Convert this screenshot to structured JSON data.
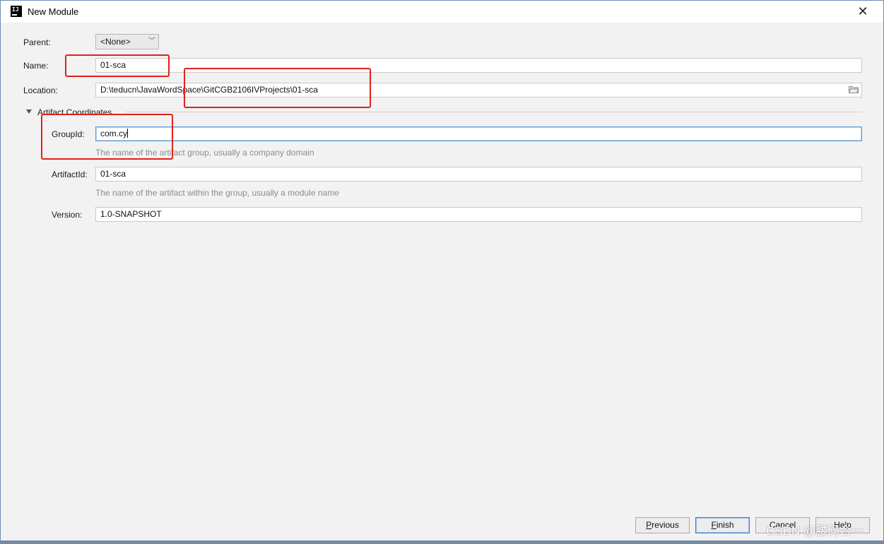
{
  "window": {
    "title": "New Module",
    "close_glyph": "✕",
    "app_icon_text": "IJ"
  },
  "form": {
    "parent": {
      "label": "Parent:",
      "value": "<None>"
    },
    "name": {
      "label": "Name:",
      "value": "01-sca"
    },
    "location": {
      "label": "Location:",
      "value": "D:\\teducn\\JavaWordSpace\\GitCGB2106IVProjects\\01-sca"
    },
    "section": {
      "label": "Artifact Coordinates"
    },
    "group_id": {
      "label": "GroupId:",
      "value": "com.cy",
      "hint": "The name of the artifact group, usually a company domain"
    },
    "artifact_id": {
      "label": "ArtifactId:",
      "value": "01-sca",
      "hint": "The name of the artifact within the group, usually a module name"
    },
    "version": {
      "label": "Version:",
      "value": "1.0-SNAPSHOT"
    }
  },
  "buttons": {
    "previous": {
      "mnemonic": "P",
      "rest": "revious"
    },
    "finish": {
      "mnemonic": "F",
      "rest": "inish"
    },
    "cancel": {
      "label": "Cancel"
    },
    "help": {
      "label": "Help"
    }
  },
  "watermark": "CSDN @腰码合一",
  "colors": {
    "highlight_box": "#e0211b",
    "focus_border": "#5a9ad6",
    "dialog_bg": "#f2f2f2"
  }
}
